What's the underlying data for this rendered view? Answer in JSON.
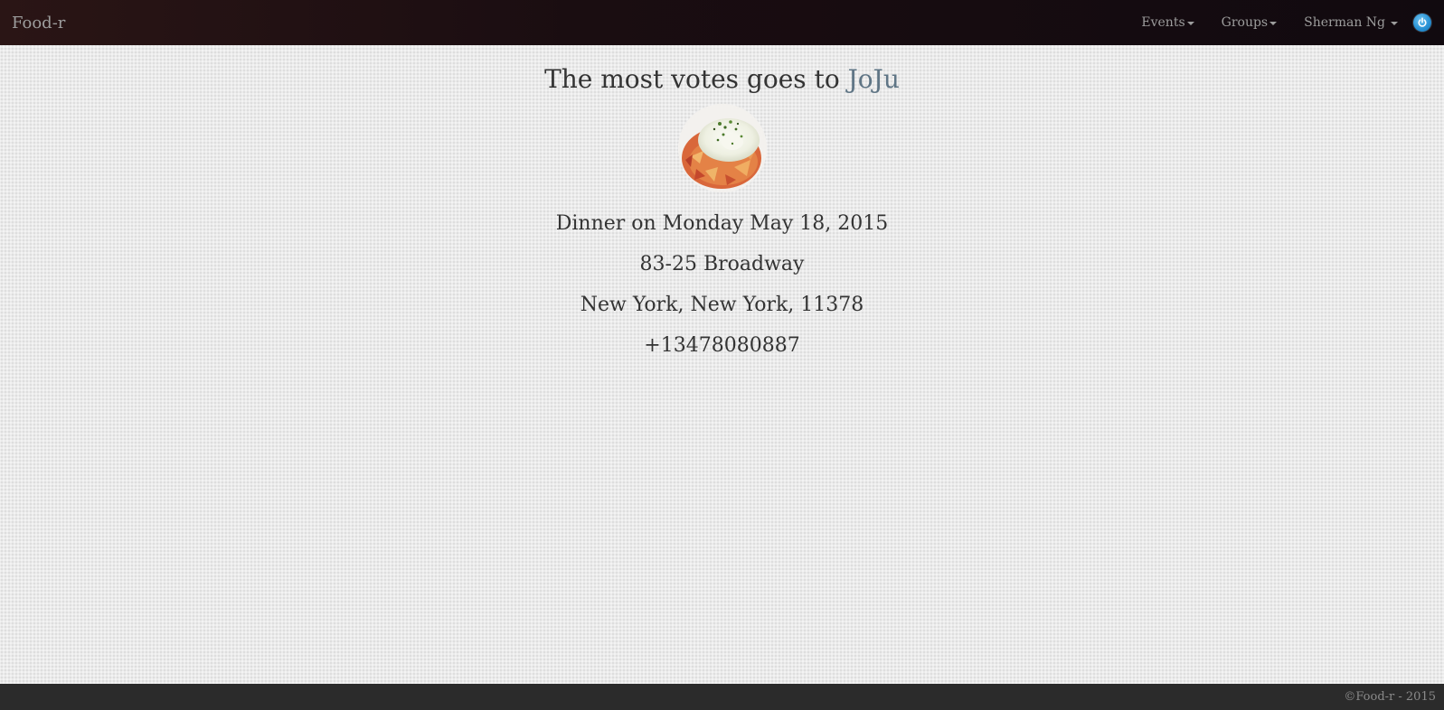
{
  "navbar": {
    "brand": "Food-r",
    "items": [
      {
        "label": "Events"
      },
      {
        "label": "Groups"
      },
      {
        "label": "Sherman Ng"
      }
    ],
    "power_icon": "power-icon"
  },
  "result": {
    "headline_prefix": "The most votes goes to ",
    "restaurant": "JoJu",
    "image": "food-photo",
    "meal": "Dinner on Monday May 18, 2015",
    "address_line1": "83-25 Broadway",
    "address_line2": "New York, New York, 11378",
    "phone": "+13478080887"
  },
  "footer": {
    "copyright": "©Food-r - 2015"
  },
  "colors": {
    "navbar": "#1a0d11",
    "link": "#5f7585",
    "footer": "#2b2b2b",
    "power_button": "#2a93d5"
  }
}
